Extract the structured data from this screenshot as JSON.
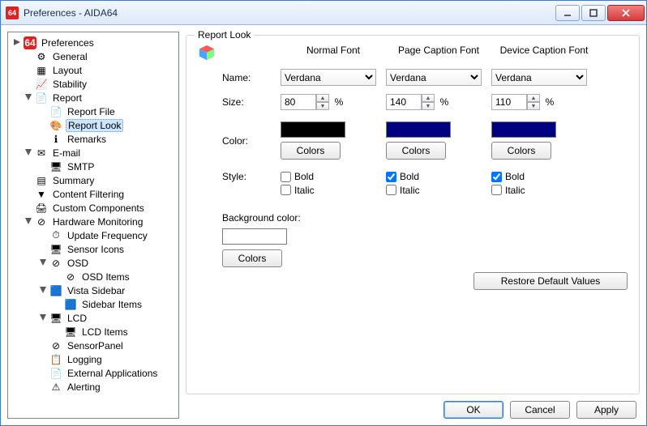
{
  "window": {
    "title": "Preferences - AIDA64"
  },
  "tree": {
    "root": "Preferences",
    "items": [
      {
        "label": "General",
        "depth": 1
      },
      {
        "label": "Layout",
        "depth": 1
      },
      {
        "label": "Stability",
        "depth": 1
      },
      {
        "label": "Report",
        "depth": 1,
        "expanded": true
      },
      {
        "label": "Report File",
        "depth": 2
      },
      {
        "label": "Report Look",
        "depth": 2,
        "selected": true
      },
      {
        "label": "Remarks",
        "depth": 2
      },
      {
        "label": "E-mail",
        "depth": 1,
        "expanded": true
      },
      {
        "label": "SMTP",
        "depth": 2
      },
      {
        "label": "Summary",
        "depth": 1
      },
      {
        "label": "Content Filtering",
        "depth": 1
      },
      {
        "label": "Custom Components",
        "depth": 1
      },
      {
        "label": "Hardware Monitoring",
        "depth": 1,
        "expanded": true
      },
      {
        "label": "Update Frequency",
        "depth": 2
      },
      {
        "label": "Sensor Icons",
        "depth": 2
      },
      {
        "label": "OSD",
        "depth": 2,
        "expanded": true
      },
      {
        "label": "OSD Items",
        "depth": 3
      },
      {
        "label": "Vista Sidebar",
        "depth": 2,
        "expanded": true
      },
      {
        "label": "Sidebar Items",
        "depth": 3
      },
      {
        "label": "LCD",
        "depth": 2,
        "expanded": true
      },
      {
        "label": "LCD Items",
        "depth": 3
      },
      {
        "label": "SensorPanel",
        "depth": 2
      },
      {
        "label": "Logging",
        "depth": 2
      },
      {
        "label": "External Applications",
        "depth": 2
      },
      {
        "label": "Alerting",
        "depth": 2
      }
    ]
  },
  "panel": {
    "title": "Report Look",
    "columns": [
      "Normal Font",
      "Page Caption Font",
      "Device Caption Font"
    ],
    "labels": {
      "name": "Name:",
      "size": "Size:",
      "color": "Color:",
      "style": "Style:",
      "bg": "Background color:",
      "colorsBtn": "Colors",
      "restore": "Restore Default Values",
      "pct": "%",
      "bold": "Bold",
      "italic": "Italic"
    },
    "fonts": {
      "normal": {
        "name": "Verdana",
        "size": "80",
        "color": "#000000",
        "bold": false,
        "italic": false
      },
      "page": {
        "name": "Verdana",
        "size": "140",
        "color": "#000080",
        "bold": true,
        "italic": false
      },
      "device": {
        "name": "Verdana",
        "size": "110",
        "color": "#000080",
        "bold": true,
        "italic": false
      }
    },
    "bgcolor": "#ffffff"
  },
  "buttons": {
    "ok": "OK",
    "cancel": "Cancel",
    "apply": "Apply"
  }
}
